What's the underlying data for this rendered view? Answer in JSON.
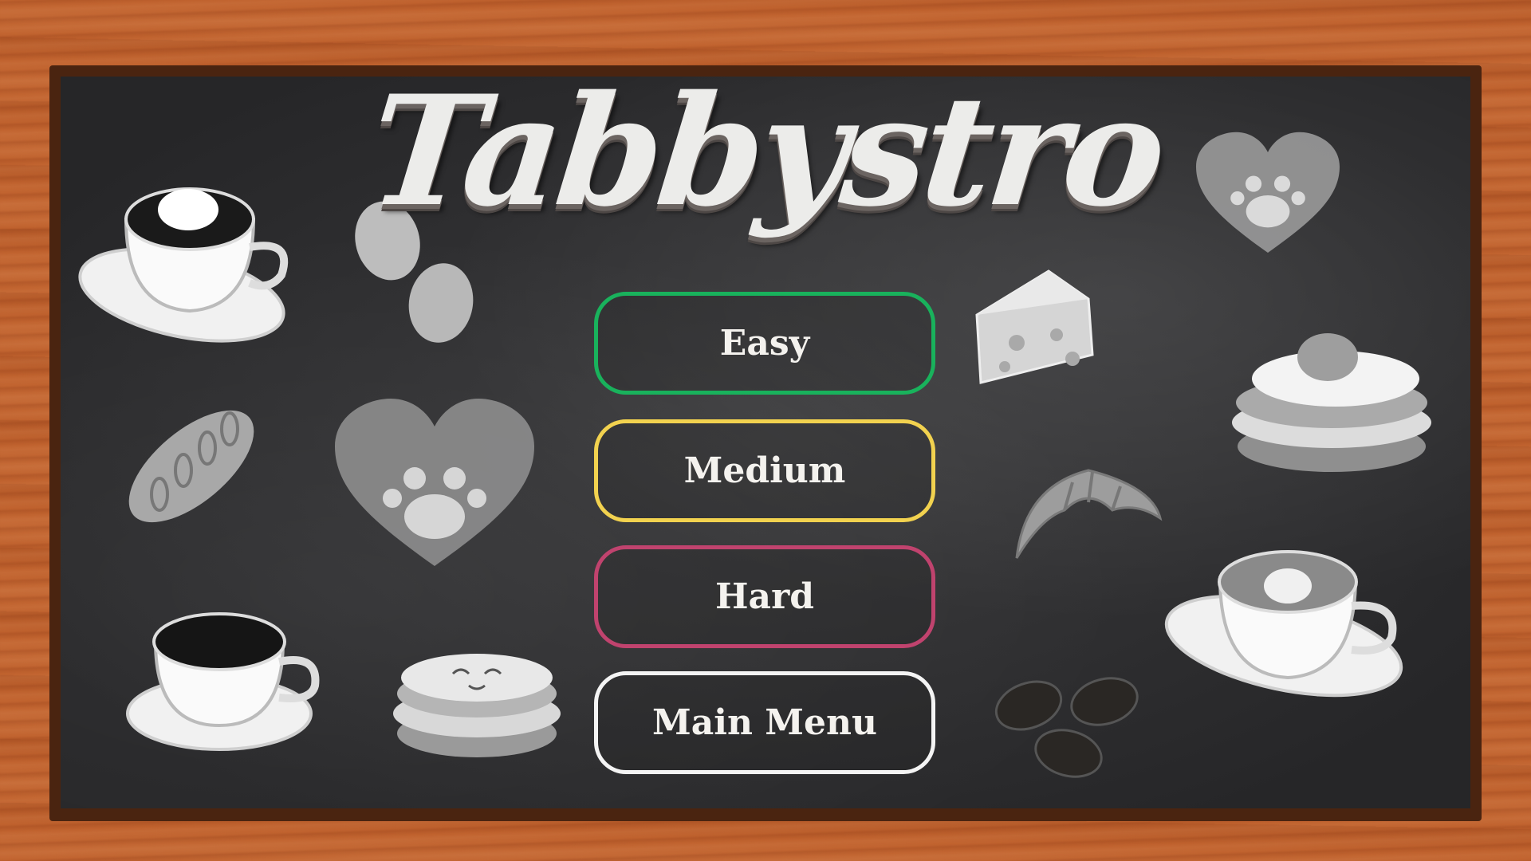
{
  "game": {
    "title": "Tabbystro"
  },
  "menu": {
    "items": [
      {
        "label": "Easy",
        "color": "#19b25c"
      },
      {
        "label": "Medium",
        "color": "#f2d24f"
      },
      {
        "label": "Hard",
        "color": "#c0436e"
      },
      {
        "label": "Main Menu",
        "color": "#f4f4f4"
      }
    ]
  },
  "decorations": {
    "icons": [
      "coffee-cup-whipped-cream-icon",
      "eggs-icon",
      "heart-paw-icon",
      "bread-loaf-icon",
      "coffee-cup-black-icon",
      "pancakes-cat-icon",
      "cheese-icon",
      "croissant-icon",
      "coffee-beans-icon",
      "pancakes-egg-icon",
      "latte-cat-art-icon"
    ]
  },
  "colors": {
    "wood": "#c0622e",
    "frame": "#4a2410",
    "chalkboard": "#2e2e30",
    "title": "#ececea"
  }
}
